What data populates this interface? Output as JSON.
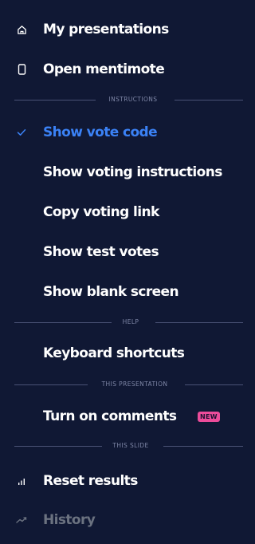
{
  "menu": {
    "items": {
      "my_presentations": {
        "label": "My presentations",
        "icon": "home-icon"
      },
      "open_mentimote": {
        "label": "Open mentimote",
        "icon": "phone-icon"
      },
      "show_vote_code": {
        "label": "Show vote code",
        "icon": "checkmark-icon",
        "active": true
      },
      "show_voting_instructions": {
        "label": "Show voting instructions"
      },
      "copy_voting_link": {
        "label": "Copy voting link"
      },
      "show_test_votes": {
        "label": "Show test votes"
      },
      "show_blank_screen": {
        "label": "Show blank screen"
      },
      "keyboard_shortcuts": {
        "label": "Keyboard shortcuts"
      },
      "turn_on_comments": {
        "label": "Turn on comments",
        "badge": "NEW"
      },
      "reset_results": {
        "label": "Reset results",
        "icon": "bar-chart-icon"
      },
      "history": {
        "label": "History",
        "icon": "trend-line-icon",
        "muted": true
      }
    },
    "sections": {
      "instructions": "INSTRUCTIONS",
      "help": "HELP",
      "this_presentation": "THIS PRESENTATION",
      "this_slide": "THIS SLIDE"
    }
  },
  "colors": {
    "background": "#101834",
    "text": "#ffffff",
    "active": "#3b82f6",
    "muted": "#6b7280",
    "badge": "#ec4c9a",
    "divider": "#4a5275"
  }
}
